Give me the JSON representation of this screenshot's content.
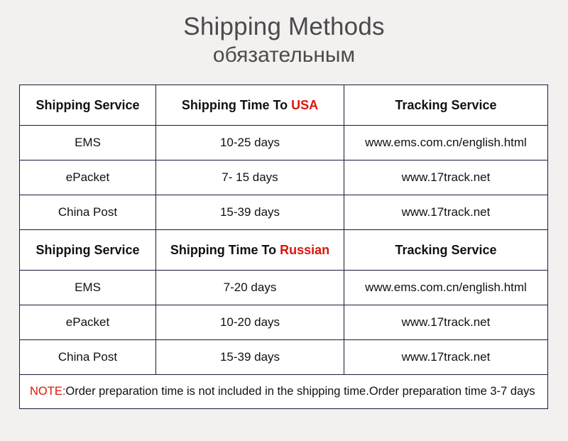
{
  "title": "Shipping Methods",
  "subtitle": "обязательным",
  "colors": {
    "accent_red": "#dd1408",
    "border": "#1a1a3a",
    "page_background": "#f3f0f0",
    "title_text": "#4a4a4a"
  },
  "table": {
    "sections": [
      {
        "header": {
          "service": "Shipping Service",
          "time_prefix": "Shipping Time To ",
          "time_region": "USA",
          "tracking": "Tracking Service"
        },
        "rows": [
          {
            "service": "EMS",
            "time": "10-25 days",
            "tracking": "www.ems.com.cn/english.html"
          },
          {
            "service": "ePacket",
            "time": "7- 15 days",
            "tracking": "www.17track.net"
          },
          {
            "service": "China Post",
            "time": "15-39 days",
            "tracking": "www.17track.net"
          }
        ]
      },
      {
        "header": {
          "service": "Shipping Service",
          "time_prefix": "Shipping Time To ",
          "time_region": "Russian",
          "tracking": "Tracking Service"
        },
        "rows": [
          {
            "service": "EMS",
            "time": "7-20 days",
            "tracking": "www.ems.com.cn/english.html"
          },
          {
            "service": "ePacket",
            "time": "10-20 days",
            "tracking": "www.17track.net"
          },
          {
            "service": "China Post",
            "time": "15-39 days",
            "tracking": "www.17track.net"
          }
        ]
      }
    ],
    "note": {
      "label": "NOTE:",
      "text": "Order preparation time is not included in the shipping time.Order preparation time 3-7 days"
    }
  }
}
